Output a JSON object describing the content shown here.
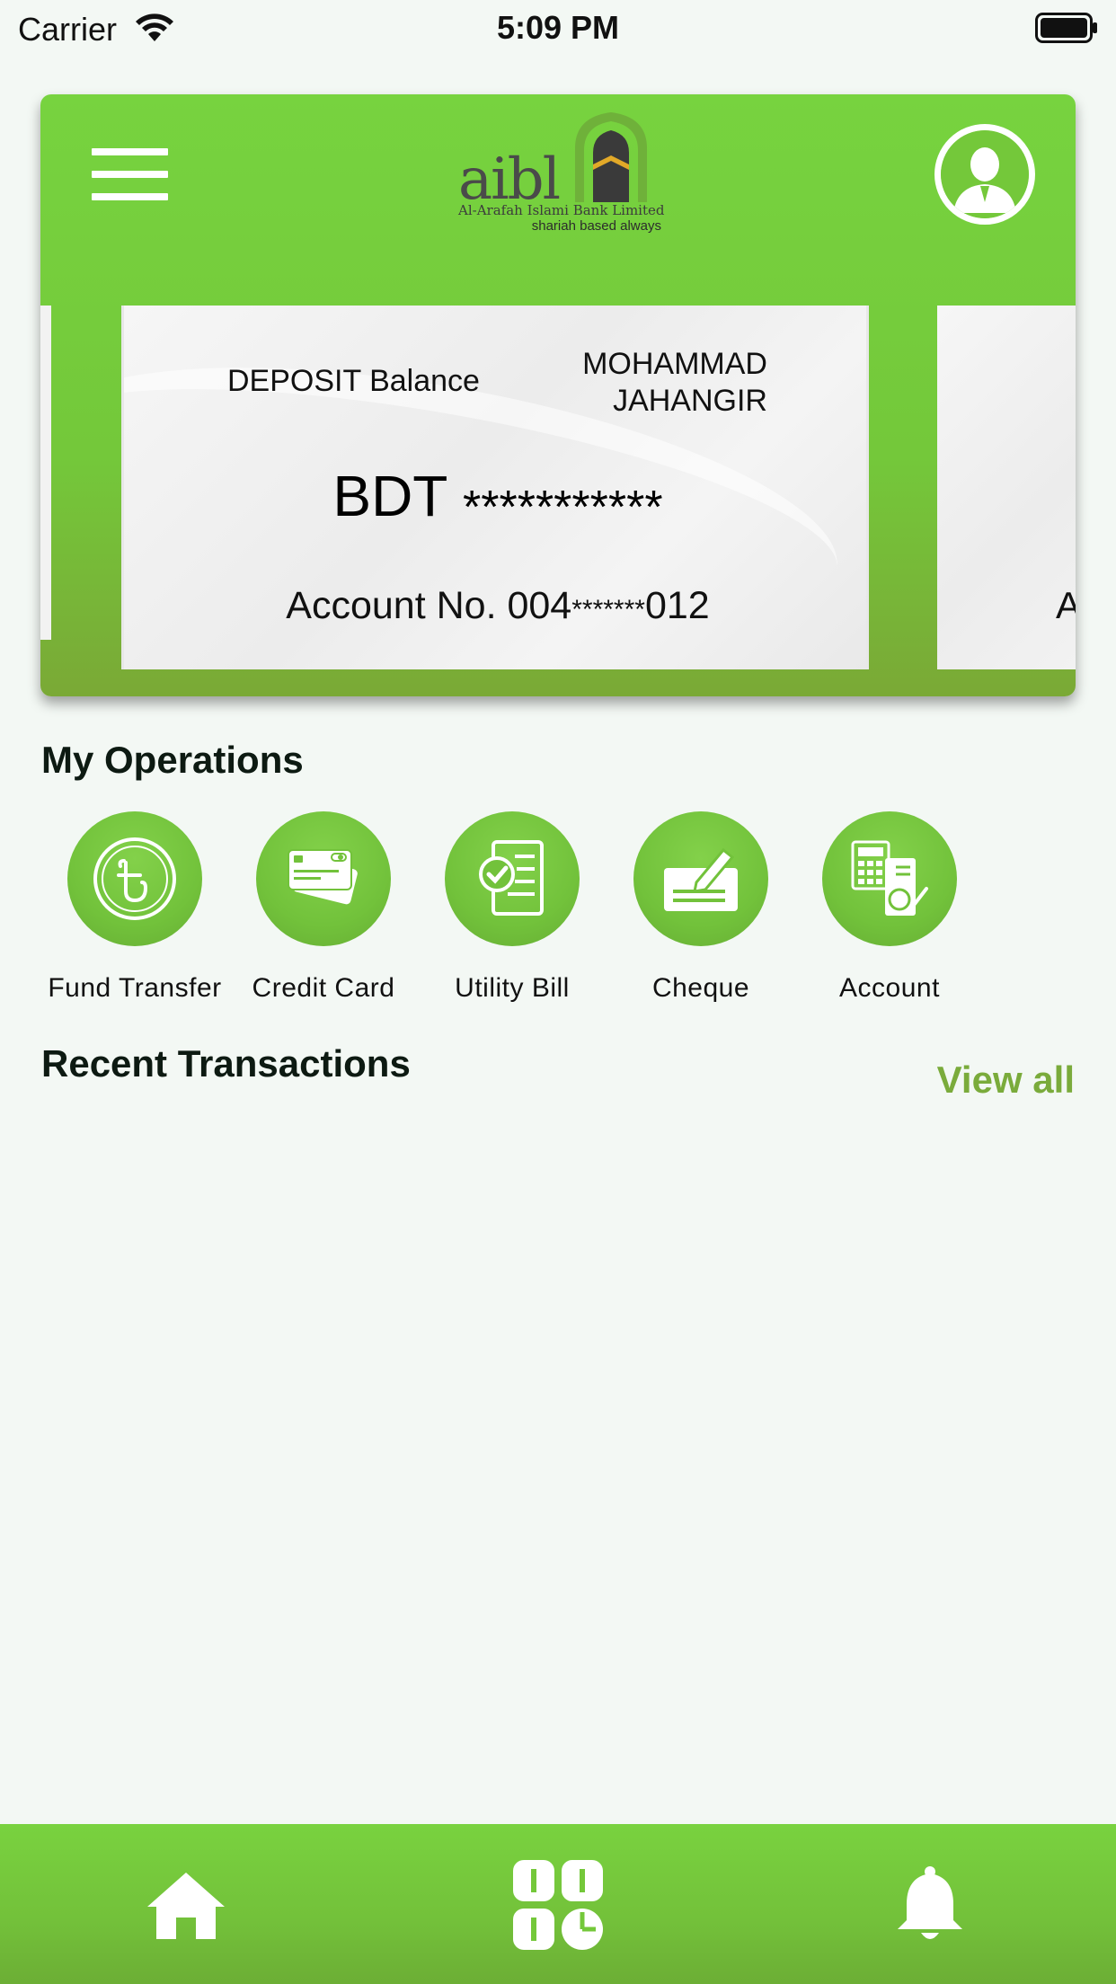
{
  "status_bar": {
    "carrier": "Carrier",
    "time": "5:09 PM"
  },
  "header": {
    "logo": {
      "wordmark": "aibl",
      "bank_name": "Al-Arafah Islami Bank Limited",
      "tagline": "shariah based always"
    }
  },
  "account_card": {
    "type_label": "DEPOSIT Balance",
    "holder_name_line1": "MOHAMMAD",
    "holder_name_line2": "JAHANGIR",
    "currency": "BDT",
    "balance_mask": "***********",
    "account_prefix": "Account No. 004",
    "account_mask": "*******",
    "account_suffix": "012",
    "next_card_peek": "A"
  },
  "operations": {
    "title": "My Operations",
    "items": [
      {
        "label": "Fund Transfer",
        "icon": "taka-icon"
      },
      {
        "label": "Credit Card",
        "icon": "credit-card-icon"
      },
      {
        "label": "Utility Bill",
        "icon": "utility-bill-icon"
      },
      {
        "label": "Cheque",
        "icon": "cheque-icon"
      },
      {
        "label": "Account",
        "icon": "account-icon"
      }
    ]
  },
  "recent": {
    "title": "Recent Transactions",
    "view_all": "View all"
  },
  "bottom_nav": {
    "items": [
      "home-icon",
      "dashboard-icon",
      "bell-icon"
    ]
  },
  "colors": {
    "brand_green": "#74c83a",
    "link_green": "#7aab3b",
    "background": "#f3f8f4"
  }
}
